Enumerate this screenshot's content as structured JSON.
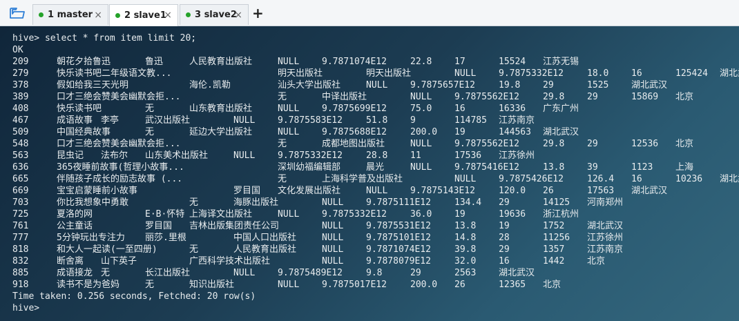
{
  "tabs": [
    {
      "label": "1 master",
      "status_color": "#25a22a",
      "close": "×"
    },
    {
      "label": "2 slave1",
      "status_color": "#25a22a",
      "close": "×",
      "active": true
    },
    {
      "label": "3 slave2",
      "status_color": "#25a22a",
      "close": "×"
    }
  ],
  "add_tab_label": "+",
  "terminal": {
    "command": "hive> select * from item limit 20;",
    "ok": "OK",
    "rows": [
      [
        "209",
        "朝花夕拾鲁迅",
        "鲁迅",
        "人民教育出版社",
        "NULL",
        "9.7871074E12",
        "22.8",
        "17",
        "15524",
        "江苏无锡"
      ],
      [
        "279",
        "快乐读书吧二年级语文教...",
        "",
        "明天出版社",
        "明天出版社",
        "NULL",
        "9.7875332E12",
        "18.0",
        "16",
        "125424",
        "湖北武汉"
      ],
      [
        "378",
        "假如给我三天光明",
        "",
        "海伦.凯勒",
        "汕头大学出版社",
        "NULL",
        "9.7875657E12",
        "19.8",
        "29",
        "1525",
        "湖北武汉"
      ],
      [
        "389",
        "口才三绝会赞美会幽默会拒...",
        "",
        "无",
        "中译出版社",
        "NULL",
        "9.7875562E12",
        "29.8",
        "29",
        "15869",
        "北京"
      ],
      [
        "408",
        "快乐读书吧",
        "无",
        "山东教育出版社",
        "NULL",
        "9.7875699E12",
        "75.0",
        "16",
        "16336",
        "广东广州"
      ],
      [
        "467",
        "成语故事",
        "李亭",
        "武汉出版社",
        "NULL",
        "9.7875583E12",
        "51.8",
        "9",
        "114785",
        "江苏南京"
      ],
      [
        "509",
        "中国经典故事",
        "无",
        "延边大学出版社",
        "NULL",
        "9.7875688E12",
        "200.0",
        "19",
        "144563",
        "湖北武汉"
      ],
      [
        "548",
        "口才三绝会赞美会幽默会拒...",
        "",
        "无",
        "成都地图出版社",
        "NULL",
        "9.7875562E12",
        "29.8",
        "29",
        "12536",
        "北京"
      ],
      [
        "563",
        "昆虫记",
        "法布尔",
        "山东美术出版社",
        "NULL",
        "9.7875332E12",
        "28.8",
        "11",
        "17536",
        "江苏徐州"
      ],
      [
        "636",
        "365夜睡前故事(哲理小故事...",
        "",
        "深圳幼福编辑部",
        "晨光",
        "NULL",
        "9.7875416E12",
        "13.8",
        "39",
        "1123",
        "上海"
      ],
      [
        "665",
        "伴随孩子成长的励志故事 (...",
        "",
        "无",
        "上海科学普及出版社",
        "NULL",
        "9.7875426E12",
        "126.4",
        "16",
        "10236",
        "湖北武汉"
      ],
      [
        "669",
        "宝宝启蒙睡前小故事",
        "",
        "罗目国",
        "文化发展出版社",
        "NULL",
        "9.7875143E12",
        "120.0",
        "26",
        "17563",
        "湖北武汉"
      ],
      [
        "703",
        "你比我想象中勇敢",
        "",
        "无",
        "海豚出版社",
        "NULL",
        "9.7875111E12",
        "134.4",
        "29",
        "14125",
        "河南郑州"
      ],
      [
        "725",
        "夏洛的网",
        "",
        "E·B·怀特",
        "上海译文出版社",
        "NULL",
        "9.7875332E12",
        "36.0",
        "19",
        "19636",
        "浙江杭州"
      ],
      [
        "761",
        "公主童话",
        "",
        "罗目国",
        "吉林出版集团责任公司",
        "NULL",
        "9.7875531E12",
        "13.8",
        "19",
        "1752",
        "湖北武汉"
      ],
      [
        "777",
        "5分钟玩出专注力",
        "丽莎.里根",
        "中国人口出版社",
        "NULL",
        "9.7875101E12",
        "14.8",
        "28",
        "11256",
        "江苏徐州"
      ],
      [
        "818",
        "和大人一起读(一至四册)",
        "无",
        "人民教育出版社",
        "NULL",
        "9.7871074E12",
        "39.8",
        "29",
        "1357",
        "江苏南京"
      ],
      [
        "832",
        "断舍离",
        "山下英子",
        "",
        "广西科学技术出版社",
        "NULL",
        "9.7878079E12",
        "32.0",
        "16",
        "1442",
        "北京"
      ],
      [
        "885",
        "成语接龙",
        "无",
        "长江出版社",
        "NULL",
        "9.7875489E12",
        "9.8",
        "29",
        "2563",
        "湖北武汉"
      ],
      [
        "918",
        "读书不是为爸妈",
        "无",
        "知识出版社",
        "NULL",
        "9.7875017E12",
        "200.0",
        "26",
        "12365",
        "北京"
      ]
    ],
    "footer": "Time taken: 0.256 seconds, Fetched: 20 row(s)",
    "prompt": "hive>"
  }
}
